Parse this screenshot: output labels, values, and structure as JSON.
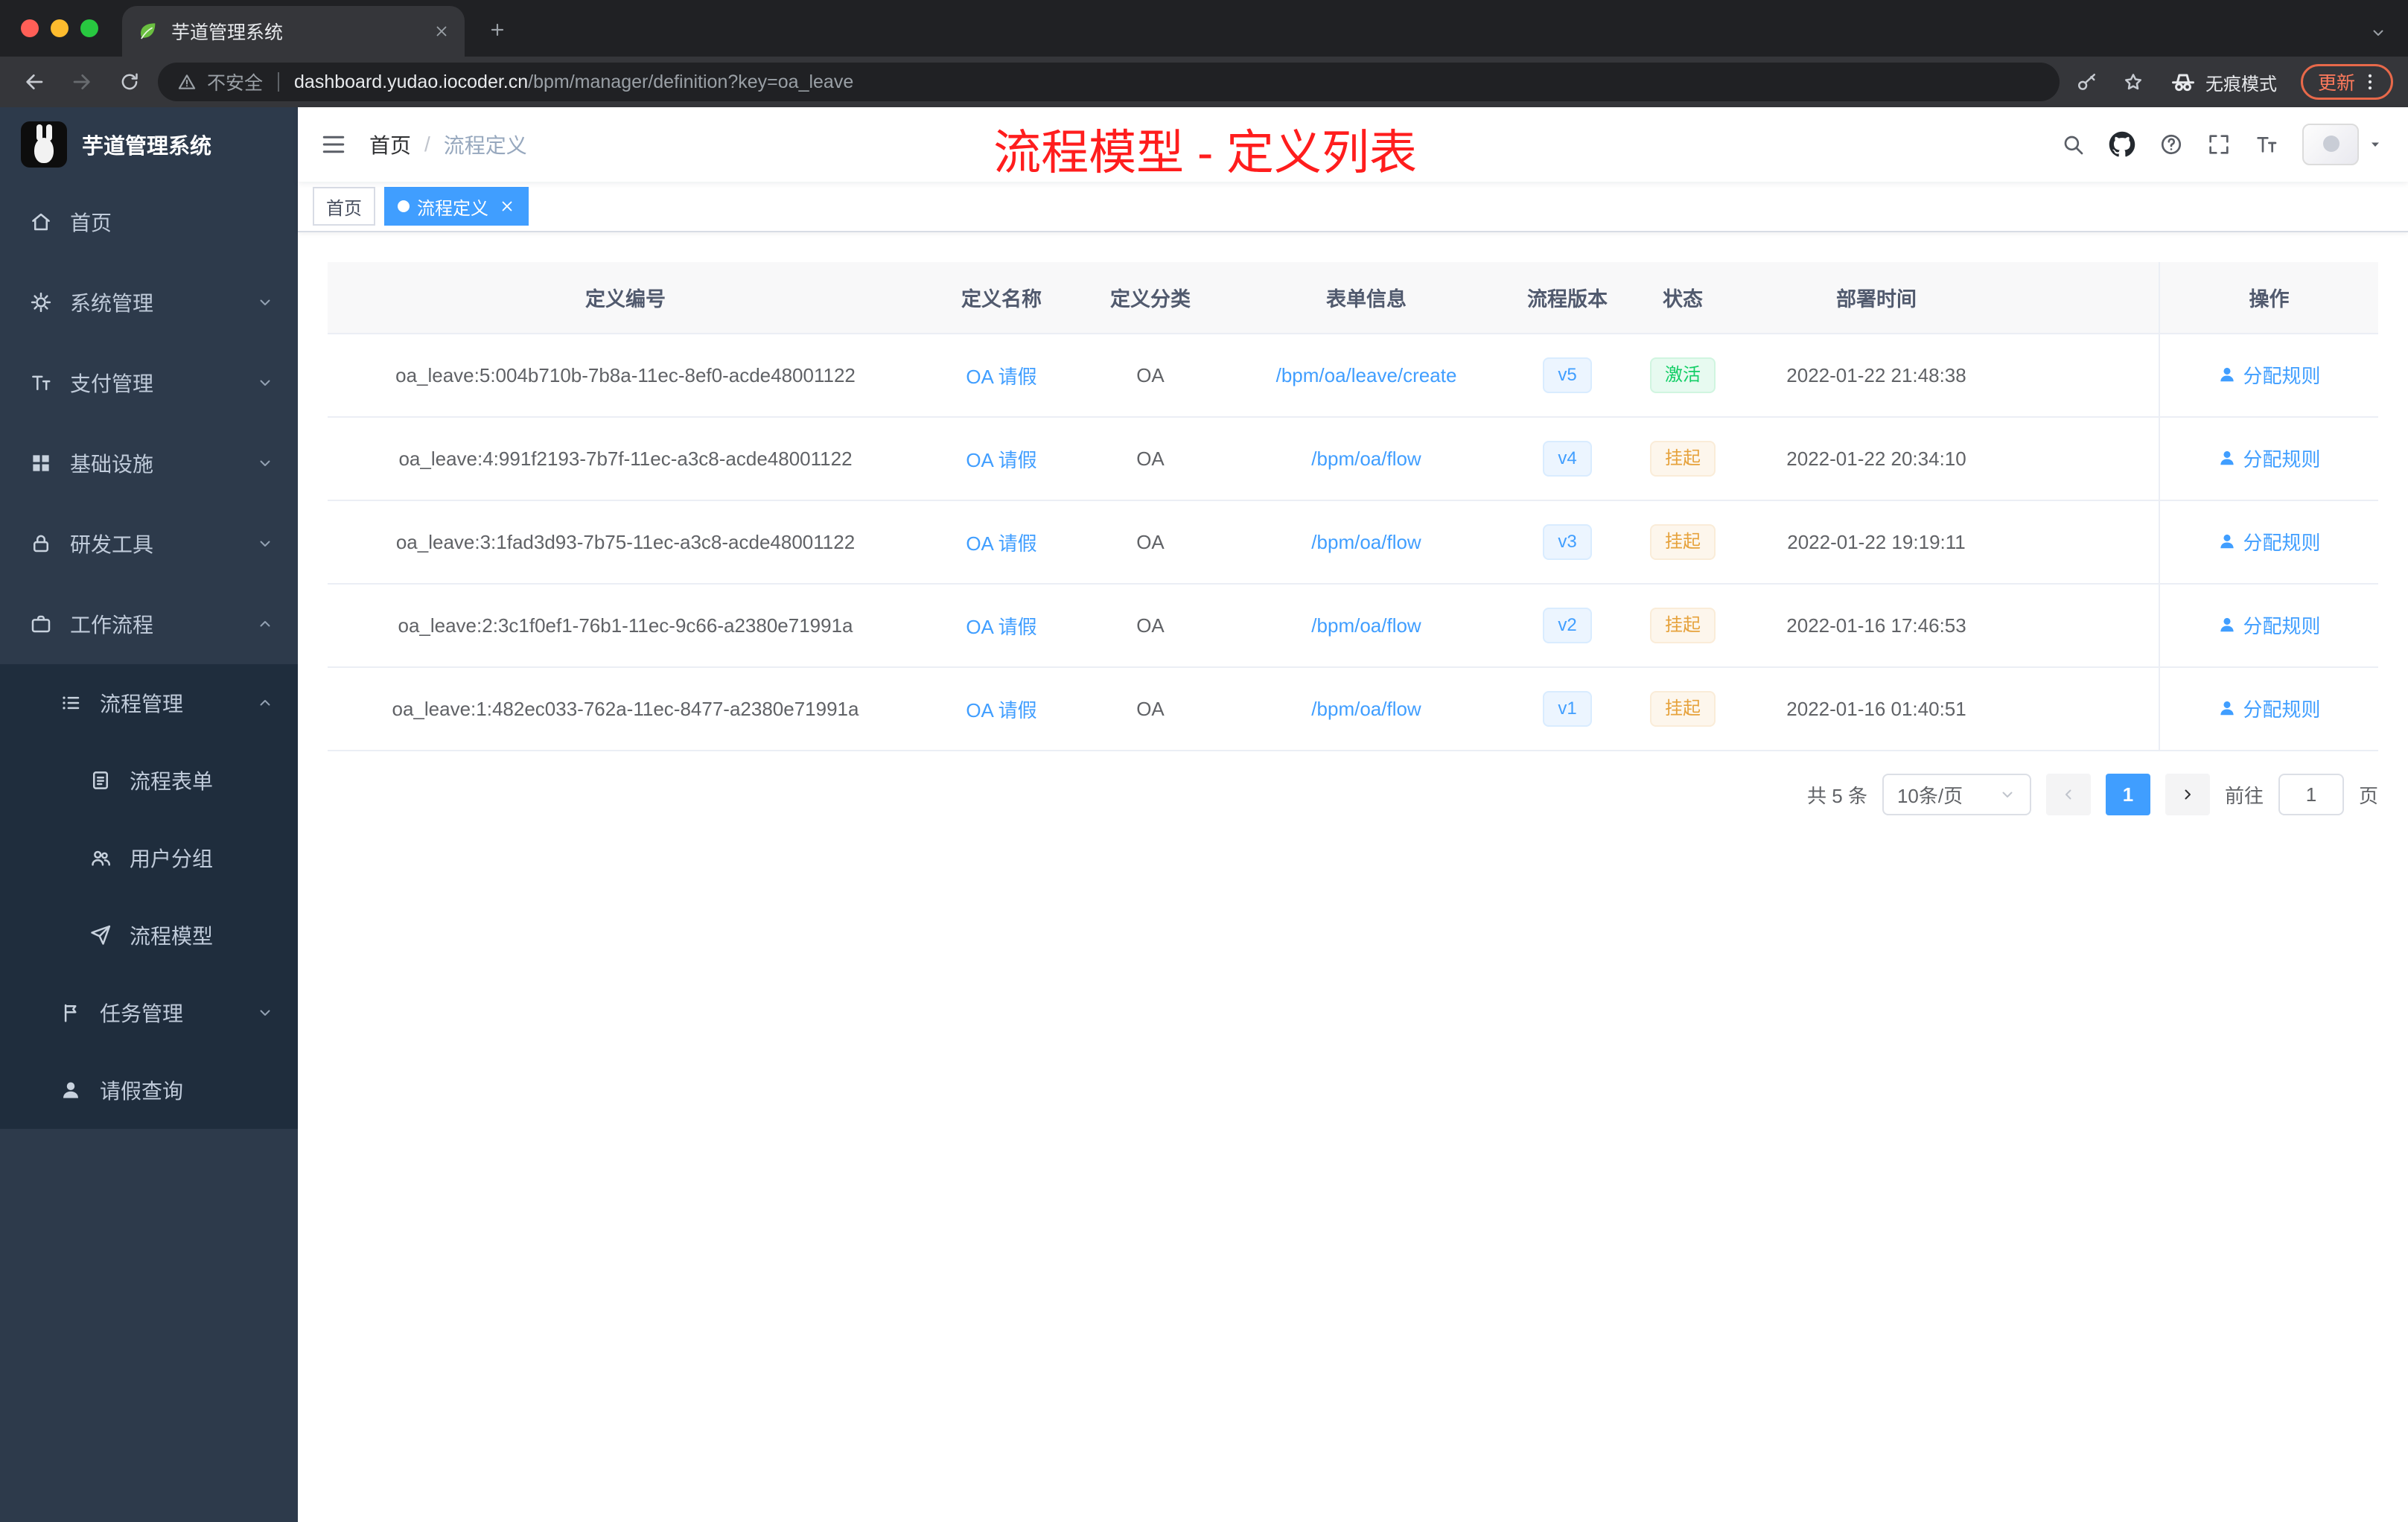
{
  "colors": {
    "accent": "#409eff",
    "annotation": "#ff1d1d",
    "success": "#13ce66",
    "warning": "#e6a23c",
    "sidebar": "#2d3a4b",
    "submenu": "#1f2d3d"
  },
  "browser": {
    "tab_title": "芋道管理系统",
    "security_label": "不安全",
    "url_domain": "dashboard.yudao.iocoder.cn",
    "url_path": "/bpm/manager/definition?key=oa_leave",
    "incognito_label": "无痕模式",
    "update_label": "更新"
  },
  "sidebar": {
    "logo_title": "芋道管理系统",
    "items": [
      {
        "label": "首页"
      },
      {
        "label": "系统管理"
      },
      {
        "label": "支付管理"
      },
      {
        "label": "基础设施"
      },
      {
        "label": "研发工具"
      },
      {
        "label": "工作流程"
      },
      {
        "label": "流程管理"
      },
      {
        "label": "流程表单"
      },
      {
        "label": "用户分组"
      },
      {
        "label": "流程模型"
      },
      {
        "label": "任务管理"
      },
      {
        "label": "请假查询"
      }
    ]
  },
  "header": {
    "breadcrumb_home": "首页",
    "breadcrumb_sep": "/",
    "breadcrumb_current": "流程定义",
    "annotation": "流程模型 - 定义列表"
  },
  "tags": {
    "home": "首页",
    "active": "流程定义"
  },
  "table": {
    "columns": {
      "id": "定义编号",
      "name": "定义名称",
      "category": "定义分类",
      "form": "表单信息",
      "version": "流程版本",
      "status": "状态",
      "deploy_time": "部署时间",
      "actions": "操作"
    },
    "rows": [
      {
        "id": "oa_leave:5:004b710b-7b8a-11ec-8ef0-acde48001122",
        "name": "OA 请假",
        "category": "OA",
        "form": "/bpm/oa/leave/create",
        "version": "v5",
        "status": "激活",
        "time": "2022-01-22 21:48:38",
        "action": "分配规则"
      },
      {
        "id": "oa_leave:4:991f2193-7b7f-11ec-a3c8-acde48001122",
        "name": "OA 请假",
        "category": "OA",
        "form": "/bpm/oa/flow",
        "version": "v4",
        "status": "挂起",
        "time": "2022-01-22 20:34:10",
        "action": "分配规则"
      },
      {
        "id": "oa_leave:3:1fad3d93-7b75-11ec-a3c8-acde48001122",
        "name": "OA 请假",
        "category": "OA",
        "form": "/bpm/oa/flow",
        "version": "v3",
        "status": "挂起",
        "time": "2022-01-22 19:19:11",
        "action": "分配规则"
      },
      {
        "id": "oa_leave:2:3c1f0ef1-76b1-11ec-9c66-a2380e71991a",
        "name": "OA 请假",
        "category": "OA",
        "form": "/bpm/oa/flow",
        "version": "v2",
        "status": "挂起",
        "time": "2022-01-16 17:46:53",
        "action": "分配规则"
      },
      {
        "id": "oa_leave:1:482ec033-762a-11ec-8477-a2380e71991a",
        "name": "OA 请假",
        "category": "OA",
        "form": "/bpm/oa/flow",
        "version": "v1",
        "status": "挂起",
        "time": "2022-01-16 01:40:51",
        "action": "分配规则"
      }
    ]
  },
  "pagination": {
    "total": "共 5 条",
    "page_size": "10条/页",
    "current_page": "1",
    "goto_label": "前往",
    "goto_value": "1",
    "page_unit": "页"
  }
}
